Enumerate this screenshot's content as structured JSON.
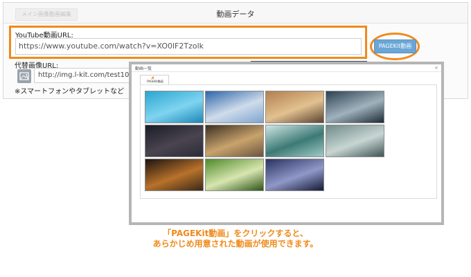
{
  "editor": {
    "back_button_label": "メイン画像動画編集",
    "title": "動画データ"
  },
  "youtube": {
    "label": "YouTube動画URL:",
    "value": "https://www.youtube.com/watch?v=XO0lF2Tzolk"
  },
  "pagekit_button_label": "PAGEKit動画",
  "alt_image": {
    "label": "代替画像URL:",
    "value": "http://img.l-kit.com/test10",
    "note": "※スマートフォンやタブレットなど"
  },
  "popup": {
    "title": "動画一覧",
    "close_symbol": "×",
    "tab_logo": "◢",
    "tab_label": "PAGEKit動画",
    "thumbnails": [
      {
        "name": "pool-water",
        "colors": [
          "#2aa6d2",
          "#7fd4ef",
          "#1c86b8"
        ]
      },
      {
        "name": "cloudy-sky",
        "colors": [
          "#2d66a8",
          "#cfdceb",
          "#7ea4cf"
        ]
      },
      {
        "name": "beach-sunset",
        "colors": [
          "#b27f4f",
          "#e2c190",
          "#5a4330"
        ]
      },
      {
        "name": "lake-dusk",
        "colors": [
          "#2e4150",
          "#9fb2bd",
          "#1d2b35"
        ]
      },
      {
        "name": "starry-mountain",
        "colors": [
          "#1a1c26",
          "#4a4450",
          "#2a2c38"
        ]
      },
      {
        "name": "mountain-peak",
        "colors": [
          "#3c3024",
          "#c9a36c",
          "#6b5440"
        ]
      },
      {
        "name": "teal-clouds",
        "colors": [
          "#cfe6e4",
          "#3d7a75",
          "#9fcac6"
        ]
      },
      {
        "name": "rocky-texture",
        "colors": [
          "#6f8a88",
          "#c8d6d3",
          "#3f5553"
        ]
      },
      {
        "name": "bokeh-lights",
        "colors": [
          "#1c1410",
          "#b8722a",
          "#3a2818"
        ]
      },
      {
        "name": "green-leaves",
        "colors": [
          "#4f8a2a",
          "#d8e6b0",
          "#2c5418"
        ]
      },
      {
        "name": "city-night",
        "colors": [
          "#2a3460",
          "#8f98c8",
          "#151a34"
        ]
      }
    ]
  },
  "caption": {
    "line1": "「PAGEKit動画」をクリックすると、",
    "line2": "あらかじめ用意された動画が使用できます。"
  }
}
